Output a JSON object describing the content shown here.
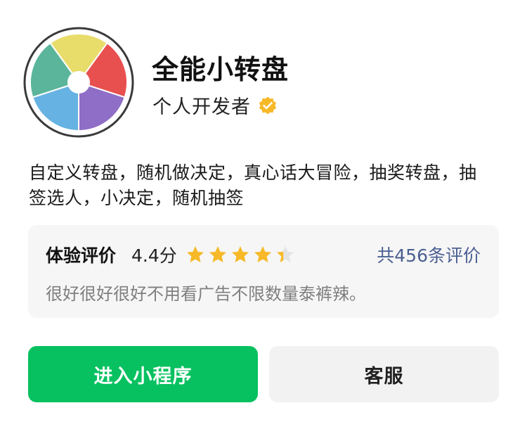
{
  "app": {
    "title": "全能小转盘",
    "developer": "个人开发者",
    "description": "自定义转盘，随机做决定，真心话大冒险，抽奖转盘，抽签选人，小决定，随机抽签"
  },
  "logo": {
    "icon": "spinning-wheel-icon",
    "colors": [
      "#e8dd6b",
      "#e85050",
      "#8f6ec7",
      "#66b3e3",
      "#5bb59b"
    ]
  },
  "rating": {
    "label": "体验评价",
    "score_text": "4.4分",
    "score": 4.4,
    "max": 5,
    "star_color": "#f7b928",
    "count_text": "共456条评价",
    "review": "很好很好很好不用看广告不限数量泰裤辣。"
  },
  "buttons": {
    "primary": "进入小程序",
    "secondary": "客服",
    "primary_color": "#07c160"
  },
  "colors": {
    "verified": "#f7b928",
    "link": "#4a5f92"
  }
}
